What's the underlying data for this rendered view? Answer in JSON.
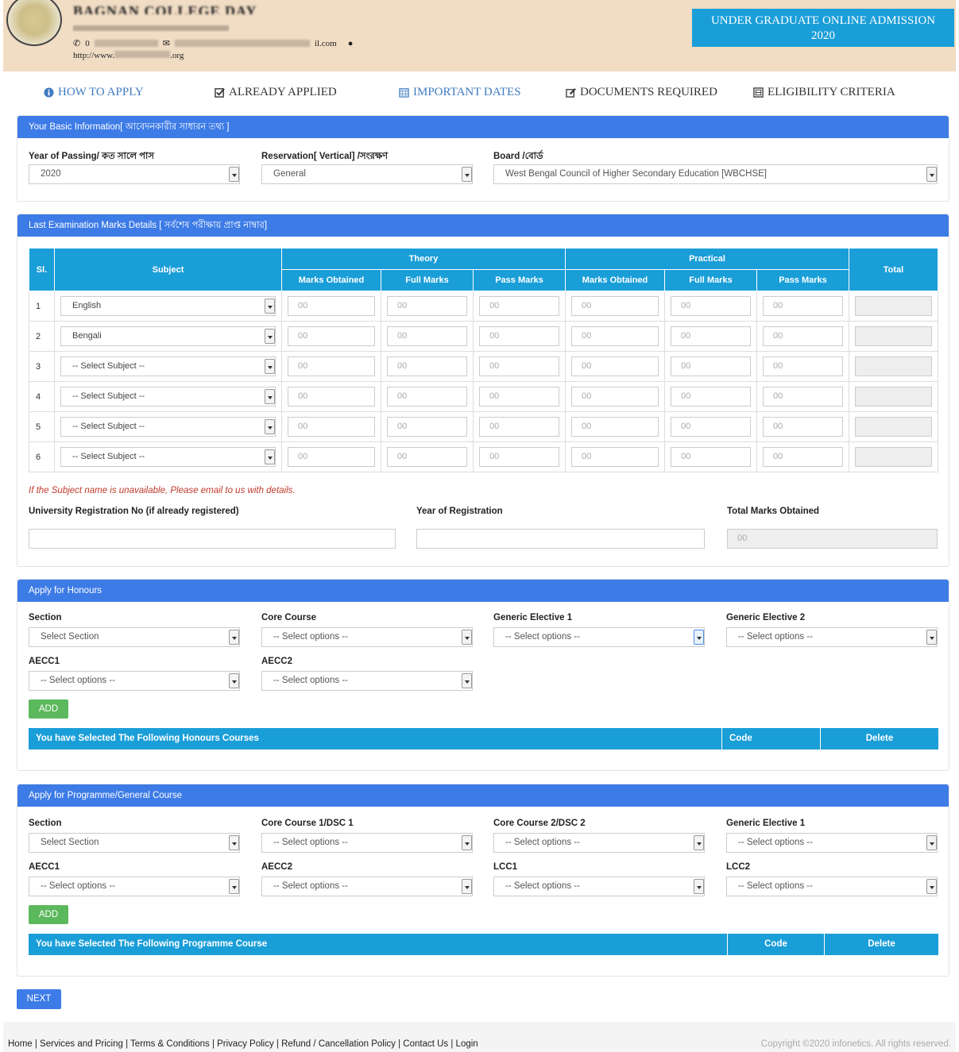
{
  "header": {
    "college_name": "BAGNAN COLLEGE DAY",
    "email_suffix": "il.com",
    "url_prefix": "http://www.",
    "url_suffix": ".org",
    "admission_title": "UNDER GRADUATE ONLINE ADMISSION",
    "admission_year": "2020"
  },
  "nav": {
    "how_to_apply": "HOW TO APPLY",
    "already_applied": "ALREADY APPLIED",
    "important_dates": "IMPORTANT DATES",
    "documents_required": "DOCUMENTS REQUIRED",
    "eligibility_criteria": "ELIGIBILITY CRITERIA"
  },
  "basic": {
    "title": "Your Basic Information[ আবেদনকারীর সাধারন তথ্য ]",
    "year_label": "Year of Passing/ কত সালে পাস",
    "year_value": "2020",
    "reservation_label": "Reservation[ Vertical] /সংরক্ষণ",
    "reservation_value": "General",
    "board_label": "Board /বোর্ড",
    "board_value": "West Bengal Council of Higher Secondary Education [WBCHSE]"
  },
  "marks": {
    "title": "Last Examination Marks Details [ সর্বশেষ পরীক্ষায় প্রাপ্ত নাম্বার]",
    "headers": {
      "sl": "Sl.",
      "subject": "Subject",
      "theory": "Theory",
      "practical": "Practical",
      "total": "Total",
      "marks_obtained": "Marks Obtained",
      "full_marks": "Full Marks",
      "pass_marks": "Pass Marks"
    },
    "placeholder": "00",
    "rows": [
      {
        "sl": "1",
        "subject": "English"
      },
      {
        "sl": "2",
        "subject": "Bengali"
      },
      {
        "sl": "3",
        "subject": "-- Select Subject --"
      },
      {
        "sl": "4",
        "subject": "-- Select Subject --"
      },
      {
        "sl": "5",
        "subject": "-- Select Subject --"
      },
      {
        "sl": "6",
        "subject": "-- Select Subject --"
      }
    ],
    "note": "If the Subject name is unavailable, Please email to us with details.",
    "univ_reg_label": "University Registration No (if already registered)",
    "year_reg_label": "Year of Registration",
    "total_marks_label": "Total Marks Obtained",
    "total_marks_value": "00"
  },
  "honours": {
    "title": "Apply for Honours",
    "section_label": "Section",
    "section_value": "Select Section",
    "core_label": "Core Course",
    "ge1_label": "Generic Elective 1",
    "ge2_label": "Generic Elective 2",
    "aecc1_label": "AECC1",
    "aecc2_label": "AECC2",
    "option_placeholder": "-- Select options --",
    "add_label": "ADD",
    "selected_label": "You have Selected The Following Honours Courses",
    "code_label": "Code",
    "delete_label": "Delete"
  },
  "programme": {
    "title": "Apply for Programme/General Course",
    "section_label": "Section",
    "section_value": "Select Section",
    "core1_label": "Core Course 1/DSC 1",
    "core2_label": "Core Course 2/DSC 2",
    "ge1_label": "Generic Elective 1",
    "aecc1_label": "AECC1",
    "aecc2_label": "AECC2",
    "lcc1_label": "LCC1",
    "lcc2_label": "LCC2",
    "option_placeholder": "-- Select options --",
    "add_label": "ADD",
    "selected_label": "You have Selected The Following Programme Course",
    "code_label": "Code",
    "delete_label": "Delete"
  },
  "next_label": "NEXT",
  "footer": {
    "links": "Home | Services and Pricing | Terms & Conditions | Privacy Policy | Refund / Cancellation Policy | Contact Us | Login",
    "copyright": "Copyright ©2020 infonetics. All rights reserved."
  }
}
